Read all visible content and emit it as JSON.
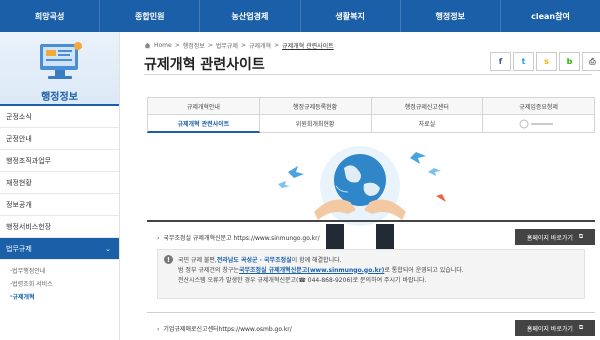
{
  "topnav": [
    "희망곡성",
    "종합민원",
    "농산업경제",
    "생활복지",
    "행정정보",
    "clean참여"
  ],
  "sidebar": {
    "title": "행정정보",
    "items": [
      "군정소식",
      "군정안내",
      "행정조직과업무",
      "재정현황",
      "정보공개",
      "행정서비스헌장"
    ],
    "active": "법무규제",
    "subitems": [
      "법무행정안내",
      "법령조회 서비스",
      "규제개혁"
    ]
  },
  "breadcrumb": [
    "Home",
    "행정정보",
    "법무규제",
    "규제개혁",
    "규제개혁 관련사이트"
  ],
  "page_title": "규제개혁 관련사이트",
  "share_icons": [
    "facebook-icon",
    "twitter-icon",
    "kakaostory-icon",
    "blog-icon",
    "print-icon"
  ],
  "tabs": {
    "row1": [
      "규제개혁안내",
      "행정규제등록현황",
      "행정규제신고센터",
      "규제입증요청제"
    ],
    "row2": [
      "규제개혁 관련사이트",
      "위원회개최현황",
      "자료실",
      ""
    ]
  },
  "sites": [
    {
      "label": "국무조정실 규제개혁신문고",
      "url": "https://www.sinmungo.go.kr/",
      "button": "홈페이지 바로가기"
    },
    {
      "label": "기업규제애로신고센터",
      "url": "https://www.osmb.go.kr/",
      "button": "홈페이지 바로가기"
    }
  ],
  "notice": {
    "line1_pre": "국민 규제 불편, ",
    "line1_hl": "전라남도 곡성군 · 국무조정실",
    "line1_post": "이 함께 해결합니다.",
    "line2_pre": "범 정부 규제건의 창구는 ",
    "line2_hl": "국무조정실 규제개혁신문고(www.sinmungo.go.kr)",
    "line2_post": "로 통합되어 운영되고 있습니다.",
    "line3": "전산시스템 오류가 발생한 경우 규제개혁신문고(☎ 044-868-9206)로 문의하여 주시기 바랍니다."
  },
  "colors": {
    "brand": "#1a5fa8",
    "button": "#444444"
  }
}
